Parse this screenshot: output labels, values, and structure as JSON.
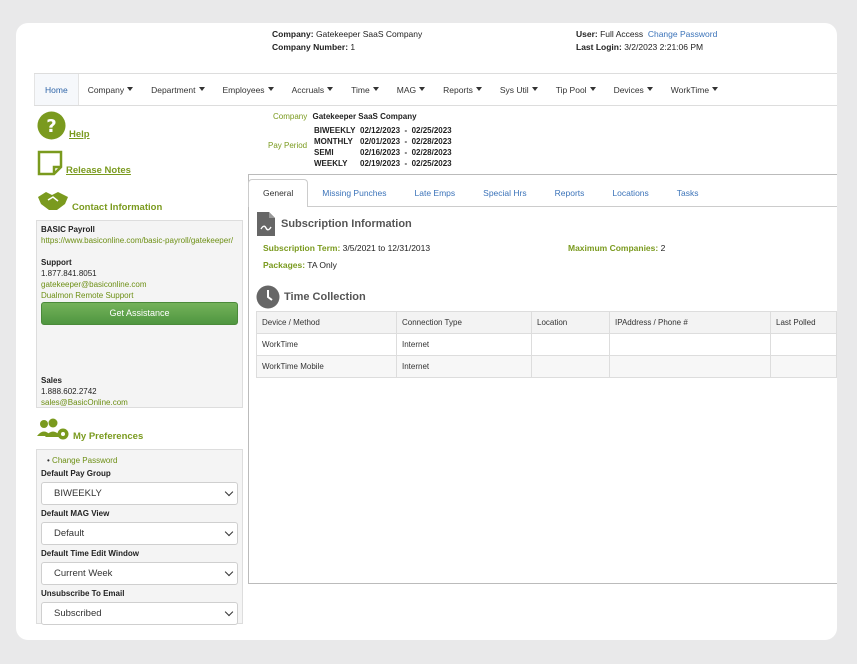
{
  "header": {
    "company_label": "Company:",
    "company_value": "Gatekeeper SaaS Company",
    "company_number_label": "Company Number:",
    "company_number_value": "1",
    "user_label": "User:",
    "user_value": "Full Access",
    "change_password_link": "Change Password",
    "last_login_label": "Last Login:",
    "last_login_value": "3/2/2023 2:21:06 PM"
  },
  "nav": [
    {
      "label": "Home",
      "dropdown": false
    },
    {
      "label": "Company",
      "dropdown": true
    },
    {
      "label": "Department",
      "dropdown": true
    },
    {
      "label": "Employees",
      "dropdown": true
    },
    {
      "label": "Accruals",
      "dropdown": true
    },
    {
      "label": "Time",
      "dropdown": true
    },
    {
      "label": "MAG",
      "dropdown": true
    },
    {
      "label": "Reports",
      "dropdown": true
    },
    {
      "label": "Sys Util",
      "dropdown": true
    },
    {
      "label": "Tip Pool",
      "dropdown": true
    },
    {
      "label": "Devices",
      "dropdown": true
    },
    {
      "label": "WorkTime",
      "dropdown": true
    }
  ],
  "sidebar": {
    "help": "Help",
    "release_notes": "Release Notes",
    "contact_title": "Contact Information",
    "contact": {
      "product": "BASIC Payroll",
      "product_url": "https://www.basiconline.com/basic-payroll/gatekeeper/",
      "support_label": "Support",
      "support_phone": "1.877.841.8051",
      "support_email": "gatekeeper@basiconline.com",
      "remote_support": "Dualmon Remote Support",
      "assist_button": "Get Assistance",
      "sales_label": "Sales",
      "sales_phone": "1.888.602.2742",
      "sales_email": "sales@BasicOnline.com"
    },
    "prefs_title": "My Preferences",
    "prefs": {
      "change_password": "Change Password",
      "pay_group_label": "Default Pay Group",
      "pay_group_value": "BIWEEKLY",
      "mag_view_label": "Default MAG View",
      "mag_view_value": "Default",
      "time_edit_label": "Default Time Edit Window",
      "time_edit_value": "Current Week",
      "unsubscribe_label": "Unsubscribe To Email",
      "unsubscribe_value": "Subscribed"
    }
  },
  "summary": {
    "company_label": "Company",
    "company_value": "Gatekeeper SaaS Company",
    "pay_period_label": "Pay Period",
    "periods": [
      {
        "name": "BIWEEKLY",
        "range": "02/12/2023  -  02/25/2023"
      },
      {
        "name": "MONTHLY",
        "range": "02/01/2023  -  02/28/2023"
      },
      {
        "name": "SEMI",
        "range": "02/16/2023  -  02/28/2023"
      },
      {
        "name": "WEEKLY",
        "range": "02/19/2023  -  02/25/2023"
      }
    ]
  },
  "tabs": [
    "General",
    "Missing Punches",
    "Late Emps",
    "Special Hrs",
    "Reports",
    "Locations",
    "Tasks"
  ],
  "subscription": {
    "title": "Subscription Information",
    "term_label": "Subscription Term:",
    "term_value": "3/5/2021 to 12/31/2013",
    "max_companies_label": "Maximum Companies:",
    "max_companies_value": "2",
    "packages_label": "Packages:",
    "packages_value": "TA Only"
  },
  "time_collection": {
    "title": "Time Collection",
    "columns": [
      "Device / Method",
      "Connection Type",
      "Location",
      "IPAddress / Phone #",
      "Last Polled"
    ],
    "rows": [
      [
        "WorkTime",
        "Internet",
        "",
        "",
        ""
      ],
      [
        "WorkTime Mobile",
        "Internet",
        "",
        "",
        ""
      ]
    ]
  },
  "colors": {
    "accent_green": "#7a9a1e",
    "link_blue": "#3b73b9",
    "button_green": "#5aa348"
  }
}
